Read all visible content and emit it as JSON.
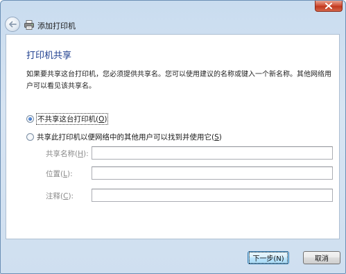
{
  "window": {
    "close_icon": "close-x-icon"
  },
  "navigation": {
    "back_icon": "back-arrow-icon",
    "wizard_icon": "printer-icon",
    "title": "添加打印机"
  },
  "page": {
    "heading": "打印机共享",
    "description": "如果要共享这台打印机，您必须提供共享名。您可以使用建议的名称或键入一个新名称。其他网络用户可以看见该共享名。"
  },
  "sharing_options": {
    "selected": "no_share",
    "no_share_label": "不共享这台打印机(",
    "no_share_key": "O",
    "no_share_tail": ")",
    "share_label": "共享此打印机以便网络中的其他用户可以找到并使用它(",
    "share_key": "S",
    "share_tail": ")"
  },
  "fields": {
    "share_name": {
      "label": "共享名称(",
      "key": "H",
      "tail": "):",
      "value": ""
    },
    "location": {
      "label": "位置(",
      "key": "L",
      "tail": "):",
      "value": ""
    },
    "comment": {
      "label": "注释(",
      "key": "C",
      "tail": "):",
      "value": ""
    }
  },
  "buttons": {
    "next_label": "下一步(N)",
    "cancel_label": "取消"
  },
  "colors": {
    "heading": "#1f3f8f",
    "frame": "#c9dcef",
    "close_button": "#c0391f"
  }
}
